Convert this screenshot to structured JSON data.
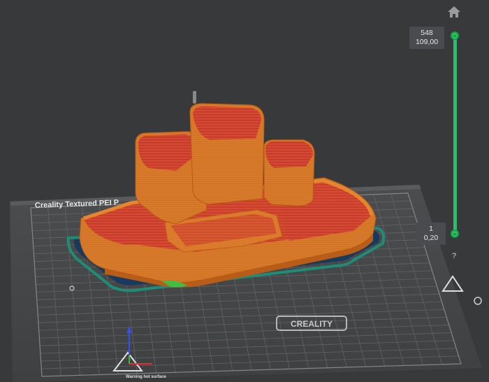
{
  "viewport": {
    "bed_label": "Creality Textured PEI P",
    "bed_brand": "CREALITY",
    "bed_warning": "Warning hot surface",
    "home_icon": "home-icon",
    "help_label": "?"
  },
  "layer_slider": {
    "top_layer": "548",
    "top_height": "109,00",
    "bottom_layer": "1",
    "bottom_height": "0,20"
  },
  "colors": {
    "background": "#38393b",
    "bed": "#474848",
    "model_orange": "#d87a2a",
    "model_red": "#c4382a",
    "brim_navy": "#173a5e",
    "skirt_teal": "#1f8f7a",
    "slider_green": "#22c55e"
  }
}
